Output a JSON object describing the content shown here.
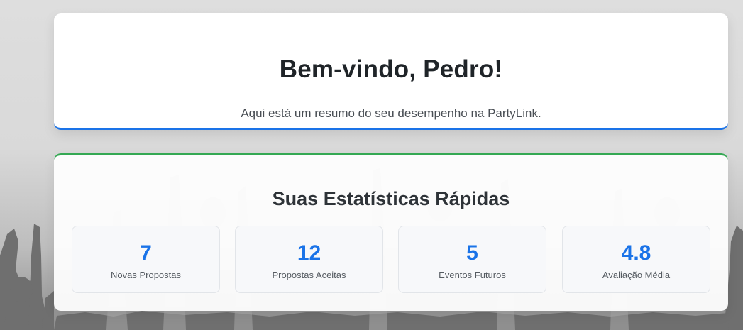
{
  "welcome": {
    "title": "Bem-vindo, Pedro!",
    "subtitle": "Aqui está um resumo do seu desempenho na PartyLink."
  },
  "stats": {
    "title": "Suas Estatísticas Rápidas",
    "items": [
      {
        "value": "7",
        "label": "Novas Propostas"
      },
      {
        "value": "12",
        "label": "Propostas Aceitas"
      },
      {
        "value": "5",
        "label": "Eventos Futuros"
      },
      {
        "value": "4.8",
        "label": "Avaliação Média"
      }
    ]
  },
  "colors": {
    "accent_blue": "#1a73e8",
    "accent_green": "#34a853",
    "text_dark": "#1f2428",
    "background": "#dedede"
  }
}
